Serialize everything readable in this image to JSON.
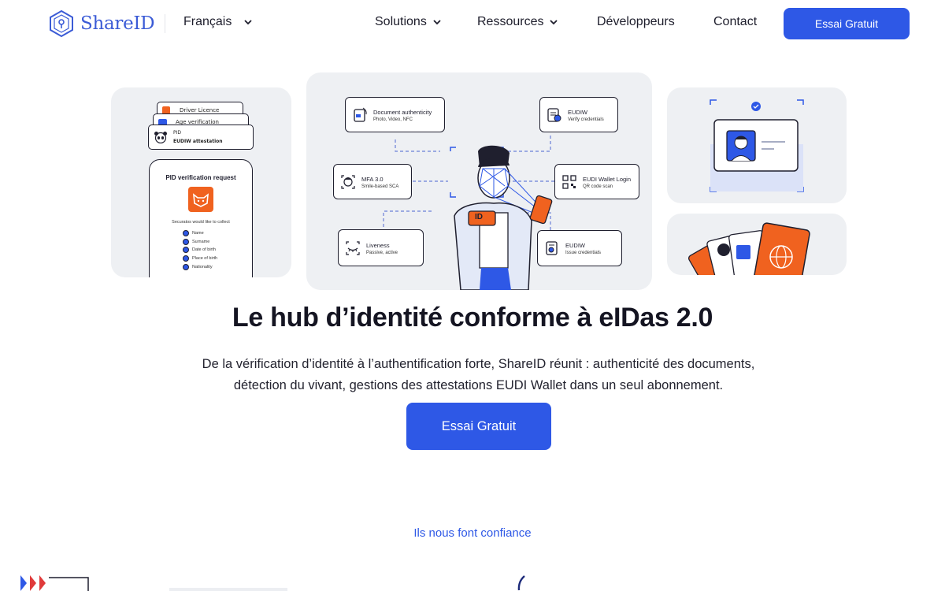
{
  "brand": {
    "name": "ShareID",
    "accent": "#2e58e6"
  },
  "nav": {
    "language": "Français",
    "links": [
      "Solutions",
      "Ressources",
      "Développeurs",
      "Contact"
    ],
    "cta": "Essai Gratuit"
  },
  "left_card": {
    "stack": [
      "Driver Licence",
      "Age verification",
      "PID",
      "EUDIW attestation"
    ],
    "phone_title": "PID verification request",
    "request_note": "Securatos would like to collect",
    "attributes": [
      "Name",
      "Surname",
      "Date of birth",
      "Place of birth",
      "Nationality"
    ]
  },
  "features": {
    "doc": {
      "title": "Document authenticity",
      "sub": "Photo, Video, NFC"
    },
    "eudiw_verify": {
      "title": "EUDIW",
      "sub": "Verify credentials"
    },
    "mfa": {
      "title": "MFA 3.0",
      "sub": "Smile-based SCA"
    },
    "wallet_login": {
      "title": "EUDI Wallet Login",
      "sub": "QR code scan"
    },
    "liveness": {
      "title": "Liveness",
      "sub": "Passive, active"
    },
    "eudiw_issue": {
      "title": "EUDIW",
      "sub": "Issue credentials"
    },
    "id_tag": "ID"
  },
  "hero": {
    "title": "Le hub d’identité conforme à eIDas 2.0",
    "subtitle_line1": "De la vérification d’identité à l’authentification forte, ShareID réunit : authenticité des documents,",
    "subtitle_line2": "détection du vivant, gestions des attestations EUDI Wallet dans un seul abonnement.",
    "cta": "Essai Gratuit"
  },
  "trust_heading": "Ils nous font confiance"
}
